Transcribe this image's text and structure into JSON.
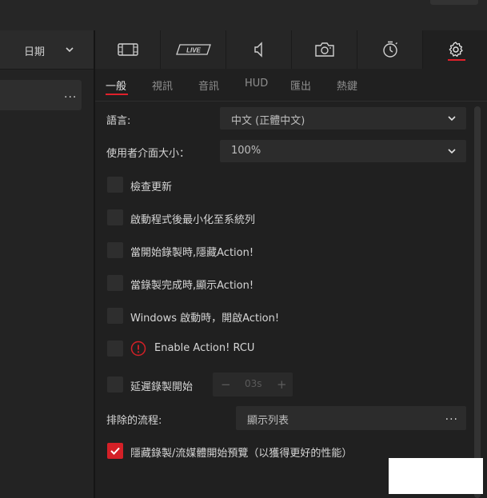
{
  "left_panel": {
    "sort_label": "日期",
    "row_more": "..."
  },
  "icon_tabs": [
    {
      "icon": "video-film-icon",
      "label": ""
    },
    {
      "icon": "live-icon",
      "label": "LIVE"
    },
    {
      "icon": "speaker-icon",
      "label": ""
    },
    {
      "icon": "camera-icon",
      "label": ""
    },
    {
      "icon": "timer-icon",
      "label": ""
    },
    {
      "icon": "gear-icon",
      "label": "",
      "active": true
    }
  ],
  "subtabs": [
    "一般",
    "視訊",
    "音訊",
    "HUD",
    "匯出",
    "熱鍵"
  ],
  "settings": {
    "language_label": "語言:",
    "language_value": "中文 (正體中文)",
    "ui_size_label": "使用者介面大小：",
    "ui_size_value": "100%",
    "check_update": "檢查更新",
    "minimize_tray": "啟動程式後最小化至系統列",
    "hide_on_record": "當開始錄製時,隱藏Action!",
    "show_on_complete": "當錄製完成時,顯示Action!",
    "windows_startup": "Windows 啟動時，開啟Action!",
    "enable_rcu": "Enable Action! RCU",
    "delay_record": "延遲錄製開始",
    "delay_value": "03s",
    "delay_minus": "−",
    "delay_plus": "+",
    "excluded_label": "排除的流程:",
    "excluded_value": "顯示列表",
    "excluded_more": "...",
    "hide_preview": "隱藏錄製/流媒體開始預覽（以獲得更好的性能）"
  },
  "colors": {
    "accent": "#d42027",
    "background": "#202020"
  }
}
